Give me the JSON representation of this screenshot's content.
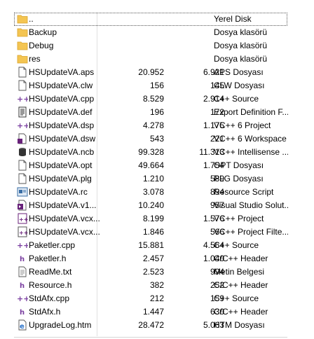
{
  "files": [
    {
      "name": "..",
      "size": "",
      "packed": "",
      "type": "Yerel Disk",
      "icon": "folder-icon",
      "selected": true
    },
    {
      "name": "Backup",
      "size": "",
      "packed": "",
      "type": "Dosya klasörü",
      "icon": "folder-icon"
    },
    {
      "name": "Debug",
      "size": "",
      "packed": "",
      "type": "Dosya klasörü",
      "icon": "folder-icon"
    },
    {
      "name": "res",
      "size": "",
      "packed": "",
      "type": "Dosya klasörü",
      "icon": "folder-icon"
    },
    {
      "name": "HSUpdateVA.aps",
      "size": "20.952",
      "packed": "6.921",
      "type": "APS Dosyası",
      "icon": "blank-file-icon"
    },
    {
      "name": "HSUpdateVA.clw",
      "size": "156",
      "packed": "145",
      "type": "CLW Dosyası",
      "icon": "blank-file-icon"
    },
    {
      "name": "HSUpdateVA.cpp",
      "size": "8.529",
      "packed": "2.914",
      "type": "C++ Source",
      "icon": "cpp-source-icon"
    },
    {
      "name": "HSUpdateVA.def",
      "size": "196",
      "packed": "172",
      "type": "Export Definition F...",
      "icon": "def-file-icon"
    },
    {
      "name": "HSUpdateVA.dsp",
      "size": "4.278",
      "packed": "1.175",
      "type": "VC++ 6 Project",
      "icon": "cpp-source-icon"
    },
    {
      "name": "HSUpdateVA.dsw",
      "size": "543",
      "packed": "221",
      "type": "VC++ 6 Workspace",
      "icon": "vs-workspace-icon"
    },
    {
      "name": "HSUpdateVA.ncb",
      "size": "99.328",
      "packed": "11.313",
      "type": "VC++ Intellisense ...",
      "icon": "database-icon"
    },
    {
      "name": "HSUpdateVA.opt",
      "size": "49.664",
      "packed": "1.754",
      "type": "OPT Dosyası",
      "icon": "blank-file-icon"
    },
    {
      "name": "HSUpdateVA.plg",
      "size": "1.210",
      "packed": "589",
      "type": "PLG Dosyası",
      "icon": "blank-file-icon"
    },
    {
      "name": "HSUpdateVA.rc",
      "size": "3.078",
      "packed": "894",
      "type": "Resource Script",
      "icon": "resource-script-icon"
    },
    {
      "name": "HSUpdateVA.v1...",
      "size": "10.240",
      "packed": "957",
      "type": "Visual Studio Solut...",
      "icon": "vs-solution-icon"
    },
    {
      "name": "HSUpdateVA.vcx...",
      "size": "8.199",
      "packed": "1.576",
      "type": "VC++ Project",
      "icon": "vcxproj-icon"
    },
    {
      "name": "HSUpdateVA.vcx...",
      "size": "1.846",
      "packed": "566",
      "type": "VC++ Project Filte...",
      "icon": "vcxproj-filter-icon"
    },
    {
      "name": "Paketler.cpp",
      "size": "15.881",
      "packed": "4.564",
      "type": "C++ Source",
      "icon": "cpp-source-icon"
    },
    {
      "name": "Paketler.h",
      "size": "2.457",
      "packed": "1.040",
      "type": "C/C++ Header",
      "icon": "header-file-icon"
    },
    {
      "name": "ReadMe.txt",
      "size": "2.523",
      "packed": "994",
      "type": "Metin Belgesi",
      "icon": "text-file-icon"
    },
    {
      "name": "Resource.h",
      "size": "382",
      "packed": "252",
      "type": "C/C++ Header",
      "icon": "header-file-icon"
    },
    {
      "name": "StdAfx.cpp",
      "size": "212",
      "packed": "159",
      "type": "C++ Source",
      "icon": "cpp-source-icon"
    },
    {
      "name": "StdAfx.h",
      "size": "1.447",
      "packed": "630",
      "type": "C/C++ Header",
      "icon": "header-file-icon"
    },
    {
      "name": "UpgradeLog.htm",
      "size": "28.472",
      "packed": "5.063",
      "type": "HTM Dosyası",
      "icon": "html-file-icon"
    }
  ],
  "colors": {
    "folder": "#f4c552",
    "folder_dark": "#d9a42b",
    "cpp_accent": "#7a3ea0",
    "vs_purple": "#68217a",
    "html_blue": "#2b72c8"
  }
}
